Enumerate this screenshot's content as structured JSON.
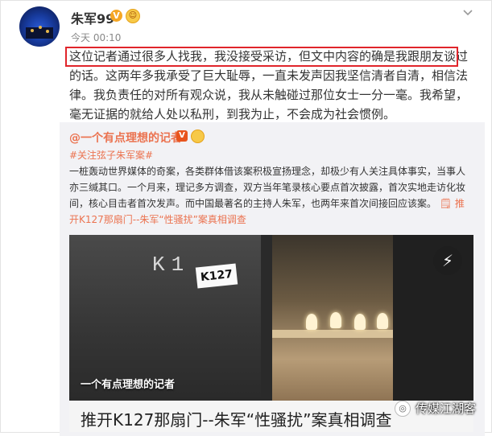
{
  "post": {
    "username": "朱军99",
    "badge": "V",
    "time": "今天 00:10",
    "text_highlight": "这位记者通过很多人找我，我没接受采访，但文中内容的确是我跟朋友谈过的",
    "text_rest": "话。这两年多我承受了巨大耻辱，一直未发声因我坚信清者自清，相信法律。我负责任的对所有观众说，我从未触碰过那位女士一分一毫。我希望，毫无证据的就给人处以私刑，到我为止，不会成为社会惯例。"
  },
  "retweet": {
    "author": "@一个有点理想的记者",
    "badge": "V",
    "hashtag": "#关注弦子朱军案#",
    "body": "一桩轰动世界媒体的奇案，各类群体借该案积极宣扬理念，却极少有人关注具体事实，当事人亦三缄其口。一个月来，理记多方调查，双方当年笔录核心要点首次披露，首次实地走访化妆间，核心目击者首次发声。而中国最著名的主持人朱军，也两年来首次间接回应该案。",
    "link": "🗒 推开K127那扇门--朱军“性骚扰”案真相调查"
  },
  "card": {
    "plate_k1": "K1",
    "plate_k127": "K127",
    "photo_caption": "一个有点理想的记者",
    "title": "推开K127那扇门--朱军“性骚扰”案真相调查"
  },
  "watermark": {
    "text": "传媒江湖客"
  },
  "colors": {
    "highlight": "#e0252b",
    "link": "#eb7350",
    "badge_orange": "#f5a623"
  },
  "icons": [
    "chevron-down-icon",
    "play-icon",
    "wechat-icon",
    "emoji-face-icon"
  ]
}
